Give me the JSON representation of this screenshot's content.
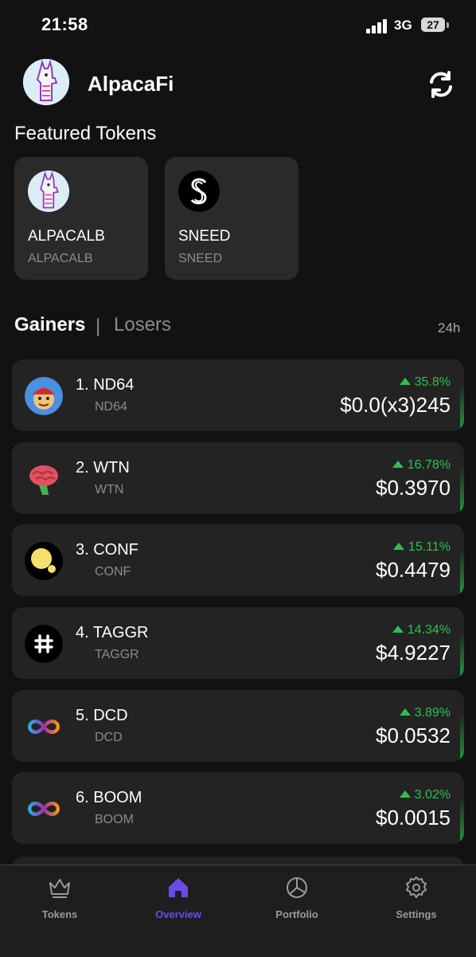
{
  "status_bar": {
    "time": "21:58",
    "network": "3G",
    "battery": "27"
  },
  "header": {
    "title": "AlpacaFi",
    "logo_icon": "alpaca-logo-icon",
    "refresh_icon": "refresh-icon"
  },
  "featured": {
    "title": "Featured Tokens",
    "items": [
      {
        "name": "ALPACALB",
        "symbol": "ALPACALB",
        "icon": "alpaca-logo-icon"
      },
      {
        "name": "SNEED",
        "symbol": "SNEED",
        "icon": "sneed-logo-icon"
      }
    ]
  },
  "tabs": {
    "gainers": "Gainers",
    "separator": "|",
    "losers": "Losers",
    "period": "24h"
  },
  "gainers": [
    {
      "name": "1. ND64",
      "symbol": "ND64",
      "change": "35.8%",
      "price": "$0.0(x3)245",
      "icon": "nd64-logo-icon"
    },
    {
      "name": "2. WTN",
      "symbol": "WTN",
      "change": "16.78%",
      "price": "$0.3970",
      "icon": "brain-logo-icon"
    },
    {
      "name": "3. CONF",
      "symbol": "CONF",
      "change": "15.11%",
      "price": "$0.4479",
      "icon": "conf-logo-icon"
    },
    {
      "name": "4. TAGGR",
      "symbol": "TAGGR",
      "change": "14.34%",
      "price": "$4.9227",
      "icon": "hash-logo-icon"
    },
    {
      "name": "5. DCD",
      "symbol": "DCD",
      "change": "3.89%",
      "price": "$0.0532",
      "icon": "infinity-logo-icon"
    },
    {
      "name": "6. BOOM",
      "symbol": "BOOM",
      "change": "3.02%",
      "price": "$0.0015",
      "icon": "infinity-logo-icon"
    }
  ],
  "nav": {
    "items": [
      {
        "label": "Tokens",
        "icon": "crown-icon"
      },
      {
        "label": "Overview",
        "icon": "home-icon",
        "active": true
      },
      {
        "label": "Portfolio",
        "icon": "pie-chart-icon"
      },
      {
        "label": "Settings",
        "icon": "gear-icon"
      }
    ]
  },
  "colors": {
    "background": "#121212",
    "card": "#232323",
    "positive": "#2ec04f",
    "accent": "#6b4be8"
  }
}
